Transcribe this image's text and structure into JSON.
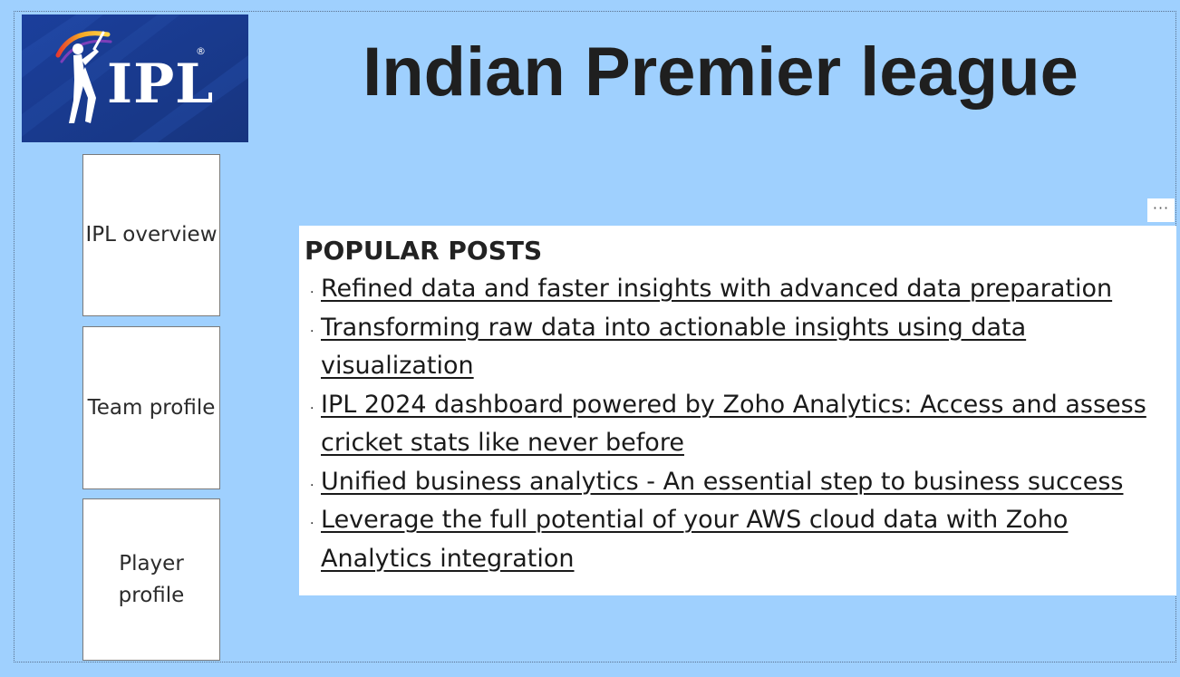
{
  "header": {
    "title": "Indian Premier league",
    "logo": {
      "text": "IPL",
      "registered_mark": "®",
      "colors": {
        "background": "#193a8f",
        "text": "#ffffff"
      }
    }
  },
  "nav": {
    "buttons": [
      {
        "label": "IPL overview"
      },
      {
        "label": "Team profile"
      },
      {
        "label": "Player profile"
      }
    ]
  },
  "posts_panel": {
    "more_label": "···",
    "heading": "POPULAR POSTS",
    "bullet": "·",
    "items": [
      {
        "text": "Refined data and faster insights with advanced data preparation"
      },
      {
        "text": "Transforming raw data into actionable insights using data visualization"
      },
      {
        "text": "IPL 2024 dashboard powered by Zoho Analytics: Access and assess cricket stats like never before"
      },
      {
        "text": "Unified business analytics - An essential step to business success"
      },
      {
        "text": "Leverage the full potential of your AWS cloud data with Zoho Analytics integration"
      }
    ]
  },
  "colors": {
    "page_background": "#9fd0fe",
    "panel_background": "#ffffff",
    "title_text": "#1f1f1f"
  }
}
